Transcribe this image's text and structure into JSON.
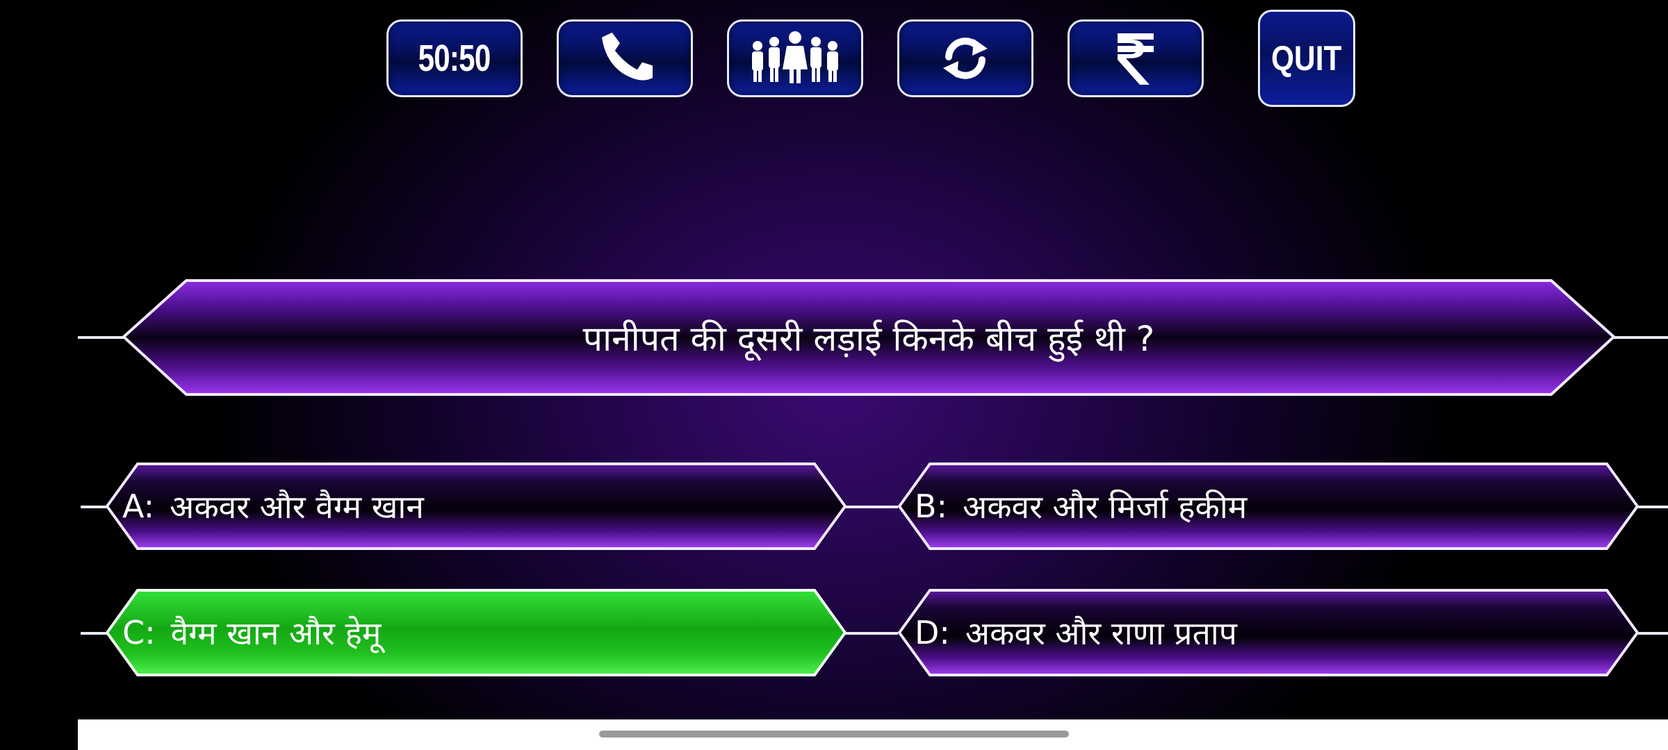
{
  "lifelines": {
    "fifty_fifty_label": "50:50",
    "quit_label": "QUIT"
  },
  "icons": {
    "phone": "phone-icon",
    "audience": "audience-icon",
    "flip": "refresh-icon",
    "rupee": "rupee-icon"
  },
  "question": {
    "text": "पानीपत की दूसरी लड़ाई किनके बीच हुई थी ?"
  },
  "options": {
    "a": {
      "letter": "A:",
      "text": "अकवर और वैग्म खान"
    },
    "b": {
      "letter": "B:",
      "text": "अकवर और मिर्जा हकीम"
    },
    "c": {
      "letter": "C:",
      "text": "वैग्म खान और हेमू"
    },
    "d": {
      "letter": "D:",
      "text": "अकवर और राणा प्रताप"
    }
  },
  "colors": {
    "panel_purple": "#7a1fc4",
    "panel_dark": "#07010f",
    "selected_green": "#1fc41f",
    "lifeline_blue": "#0a1a8c"
  }
}
